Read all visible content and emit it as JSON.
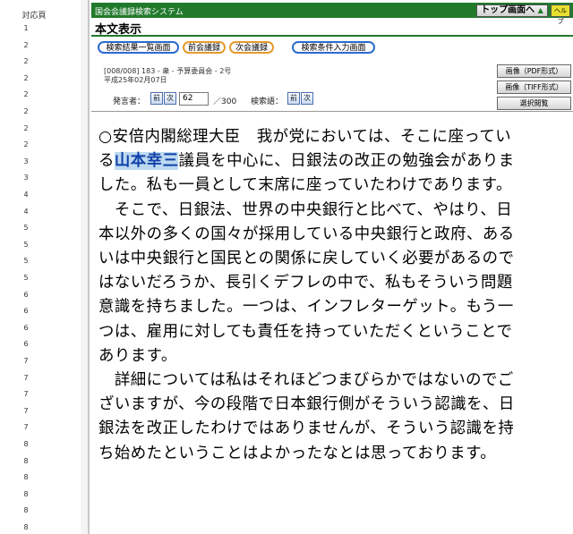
{
  "left_frame": {
    "title": "対応頁",
    "page_numbers": [
      "1",
      "2",
      "2",
      "2",
      "2",
      "2",
      "2",
      "2",
      "3",
      "3",
      "4",
      "4",
      "5",
      "5",
      "5",
      "5",
      "6",
      "6",
      "6",
      "6",
      "7",
      "7",
      "7",
      "7",
      "7",
      "8",
      "8",
      "8",
      "8",
      "8",
      "8"
    ]
  },
  "header": {
    "system_title": "国会会議録検索システム",
    "top_button_label": "トップ画面へ",
    "top_button_icon": "up-triangle-icon",
    "help_label": "ヘルプ",
    "page_heading": "本文表示"
  },
  "nav": {
    "search_results": "検索結果一覧画面",
    "prev_meeting": "前会議録",
    "next_meeting": "次会議録",
    "search_conditions": "検索条件入力画面"
  },
  "meeting": {
    "info": "[008/008] 183 - 衆 - 予算委員会 - 2号",
    "date": "平成25年02月07日"
  },
  "controls": {
    "speaker_label": "発言者：",
    "prev_label": "前",
    "next_label": "次",
    "speaker_number": "62",
    "speaker_total": "／300",
    "search_term_label": "検索語：",
    "search_prev_label": "前",
    "search_next_label": "次"
  },
  "formats": {
    "pdf": "画像（PDF形式）",
    "tiff": "画像（TIFF形式）",
    "selected": "選択閲覧"
  },
  "speech": {
    "lines": [
      {
        "before": "○安倍内閣総理大臣　我が党においては、そこに座ってい",
        "highlight": "",
        "after": ""
      },
      {
        "before": "る",
        "highlight": "山本幸三",
        "after": "議員を中心に、日銀法の改正の勉強会がありま"
      },
      {
        "before": "した。私も一員として末席に座っていたわけであります。",
        "highlight": "",
        "after": ""
      },
      {
        "before": "　そこで、日銀法、世界の中央銀行と比べて、やはり、日",
        "highlight": "",
        "after": ""
      },
      {
        "before": "本以外の多くの国々が採用している中央銀行と政府、ある",
        "highlight": "",
        "after": ""
      },
      {
        "before": "いは中央銀行と国民との関係に戻していく必要があるので",
        "highlight": "",
        "after": ""
      },
      {
        "before": "はないだろうか、長引くデフレの中で、私もそういう問題",
        "highlight": "",
        "after": ""
      },
      {
        "before": "意識を持ちました。一つは、インフレターゲット。もう一",
        "highlight": "",
        "after": ""
      },
      {
        "before": "つは、雇用に対しても責任を持っていただくということで",
        "highlight": "",
        "after": ""
      },
      {
        "before": "あります。",
        "highlight": "",
        "after": ""
      },
      {
        "before": "　詳細については私はそれほどつまびらかではないのでご",
        "highlight": "",
        "after": ""
      },
      {
        "before": "ざいますが、今の段階で日本銀行側がそういう認識を、日",
        "highlight": "",
        "after": ""
      },
      {
        "before": "銀法を改正したわけではありませんが、そういう認識を持",
        "highlight": "",
        "after": ""
      },
      {
        "before": "ち始めたということはよかったなとは思っております。",
        "highlight": "",
        "after": ""
      }
    ]
  },
  "colors": {
    "header_green": "#217a2c",
    "nav_blue": "#2a6bd0",
    "nav_orange": "#e69a2c",
    "highlight_bg": "#bcd9f1",
    "highlight_text": "#1040a8"
  }
}
